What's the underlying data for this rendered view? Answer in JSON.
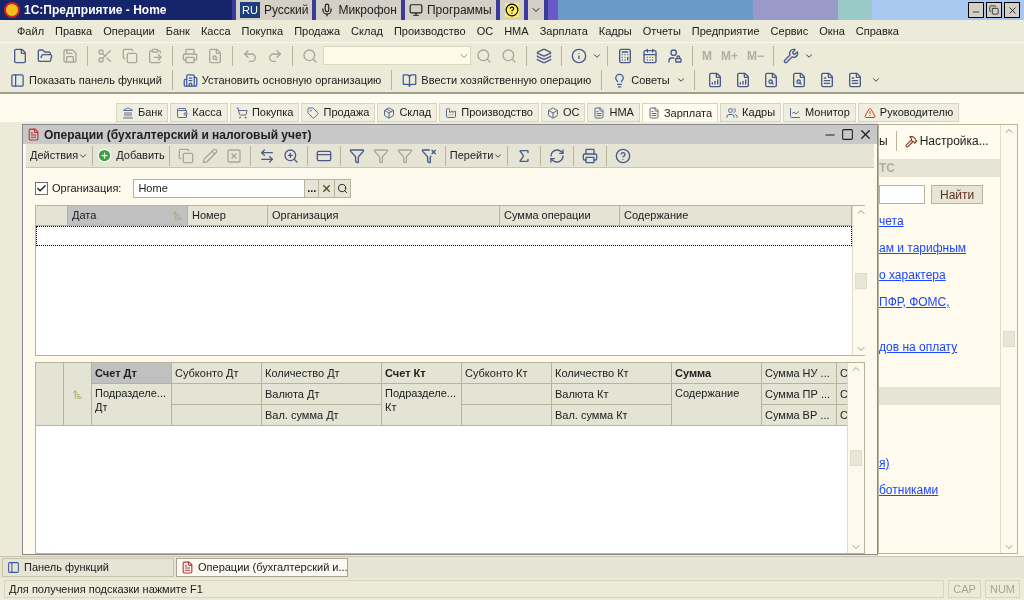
{
  "app_title": "1С:Предприятие - Home",
  "taskbar": [
    {
      "kind": "lang",
      "badge": "RU",
      "label": "Русский"
    },
    {
      "kind": "mic",
      "label": "Микрофон"
    },
    {
      "kind": "programs",
      "label": "Программы"
    },
    {
      "kind": "help"
    },
    {
      "kind": "more"
    }
  ],
  "menu": [
    "Файл",
    "Правка",
    "Операции",
    "Банк",
    "Касса",
    "Покупка",
    "Продажа",
    "Склад",
    "Производство",
    "ОС",
    "НМА",
    "Зарплата",
    "Кадры",
    "Отчеты",
    "Предприятие",
    "Сервис",
    "Окна",
    "Справка"
  ],
  "memory_buttons": [
    "M",
    "M+",
    "M−"
  ],
  "toolbar2": [
    {
      "kind": "panel",
      "label": "Показать панель функций"
    },
    {
      "kind": "org",
      "label": "Установить основную организацию"
    },
    {
      "kind": "operation",
      "label": "Ввести хозяйственную операцию"
    },
    {
      "kind": "tips",
      "label": "Советы"
    }
  ],
  "function_tabs": [
    {
      "label": "Банк",
      "selected": false
    },
    {
      "label": "Касса",
      "selected": false
    },
    {
      "label": "Покупка",
      "selected": false
    },
    {
      "label": "Продажа",
      "selected": false
    },
    {
      "label": "Склад",
      "selected": false
    },
    {
      "label": "Производство",
      "selected": false
    },
    {
      "label": "ОС",
      "selected": false
    },
    {
      "label": "НМА",
      "selected": false
    },
    {
      "label": "Зарплата",
      "selected": true
    },
    {
      "label": "Кадры",
      "selected": false
    },
    {
      "label": "Монитор",
      "selected": false
    },
    {
      "label": "Руководителю",
      "selected": false
    }
  ],
  "right_panel": {
    "toolbar_fragment": "ы",
    "settings_button": "Настройка...",
    "section_header": "ТС",
    "search_button": "Найти",
    "links": [
      "чета",
      "ам и тарифным",
      "о характера",
      "ПФР, ФОМС,",
      "дов на оплату",
      "я)",
      "ботниками"
    ]
  },
  "child_window": {
    "title": "Операции (бухгалтерский и налоговый учет)",
    "actions_menu": "Действия",
    "add_button": "Добавить",
    "goto_menu": "Перейти",
    "filter": {
      "checked": true,
      "label": "Организация:",
      "value": "Home",
      "choose_button": "..."
    },
    "operations_table": {
      "columns": [
        {
          "label": "Дата",
          "sorted": true
        },
        {
          "label": "Номер",
          "sorted": false
        },
        {
          "label": "Организация",
          "sorted": false
        },
        {
          "label": "Сумма операции",
          "sorted": false
        },
        {
          "label": "Содержание",
          "sorted": false
        }
      ]
    },
    "entries_table": {
      "columns": [
        {
          "kind": "merged",
          "header": "Счет Дт",
          "bold": true,
          "sorted": true,
          "sub": [
            "Подразделе... Дт"
          ]
        },
        {
          "kind": "blank",
          "header": "Субконто Дт",
          "bold": false,
          "sorted": false
        },
        {
          "kind": "triple",
          "header": "Количество Дт",
          "bold": false,
          "sorted": false,
          "sub": [
            "Валюта Дт",
            "Вал. сумма Дт"
          ]
        },
        {
          "kind": "merged",
          "header": "Счет Кт",
          "bold": true,
          "sorted": false,
          "sub": [
            "Подразделе... Кт"
          ]
        },
        {
          "kind": "blank",
          "header": "Субконто Кт",
          "bold": false,
          "sorted": false
        },
        {
          "kind": "triple",
          "header": "Количество Кт",
          "bold": false,
          "sorted": false,
          "sub": [
            "Валюта Кт",
            "Вал. сумма Кт"
          ]
        },
        {
          "kind": "merged",
          "header": "Сумма",
          "bold": true,
          "sorted": false,
          "sub": [
            "Содержание"
          ]
        },
        {
          "kind": "triple",
          "header": "Сумма НУ ...",
          "bold": false,
          "sorted": false,
          "sub": [
            "Сумма ПР ...",
            "Сумма ВР ..."
          ]
        },
        {
          "kind": "triple",
          "header": "С",
          "bold": false,
          "sorted": false,
          "sub": [
            "С",
            "С"
          ]
        }
      ]
    }
  },
  "windows_bar": [
    {
      "kind": "panel",
      "label": "Панель функций",
      "selected": false
    },
    {
      "kind": "document",
      "label": "Операции (бухгалтерский и...",
      "selected": true
    }
  ],
  "status_bar": {
    "hint": "Для получения подсказки нажмите F1",
    "indicators": [
      "CAP",
      "NUM"
    ]
  }
}
